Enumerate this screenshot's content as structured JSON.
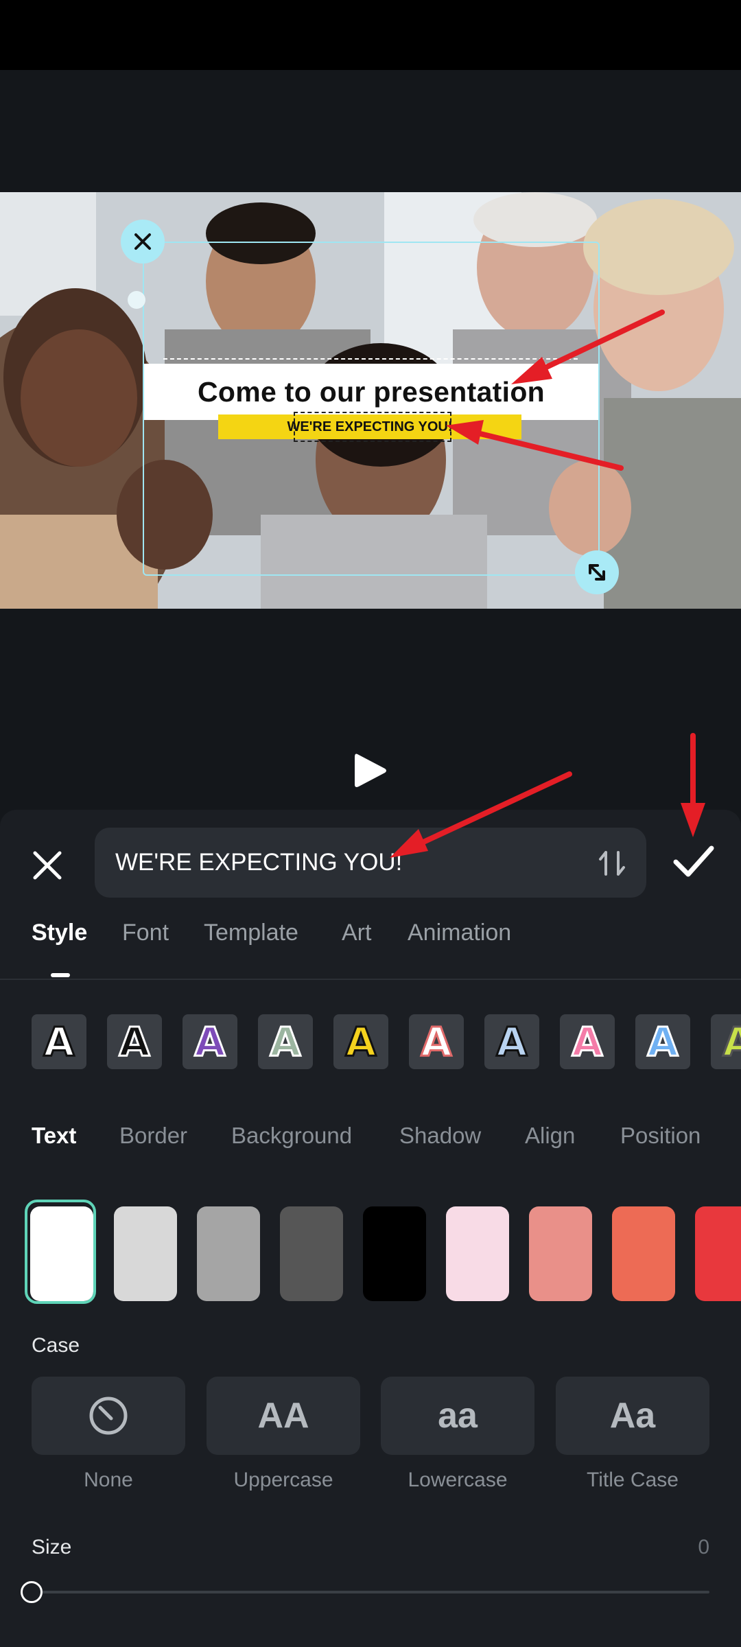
{
  "preview": {
    "overlay_title": "Come to our presentation",
    "overlay_subtitle": "WE'RE EXPECTING YOU!"
  },
  "editor": {
    "input_value": "WE'RE EXPECTING YOU!"
  },
  "tabs": [
    {
      "label": "Style",
      "active": true
    },
    {
      "label": "Font"
    },
    {
      "label": "Template"
    },
    {
      "label": "Art"
    },
    {
      "label": "Animation"
    }
  ],
  "preset_letter": "A",
  "subtabs": [
    {
      "label": "Text",
      "active": true
    },
    {
      "label": "Border"
    },
    {
      "label": "Background"
    },
    {
      "label": "Shadow"
    },
    {
      "label": "Align"
    },
    {
      "label": "Position"
    }
  ],
  "colors": {
    "accent": "#5fd4b8",
    "annotation_arrow": "#e41e26",
    "swatches": [
      "#ffffff",
      "#d8d8d8",
      "#a5a5a5",
      "#565656",
      "#000000",
      "#f8dbe6",
      "#e99089",
      "#ed6b55",
      "#e8383d"
    ]
  },
  "case": {
    "label": "Case",
    "options": [
      {
        "label": "None",
        "icon": "no-case-icon"
      },
      {
        "label": "Uppercase",
        "sample": "AA"
      },
      {
        "label": "Lowercase",
        "sample": "aa"
      },
      {
        "label": "Title Case",
        "sample": "Aa"
      }
    ]
  },
  "size": {
    "label": "Size",
    "value": "0"
  }
}
